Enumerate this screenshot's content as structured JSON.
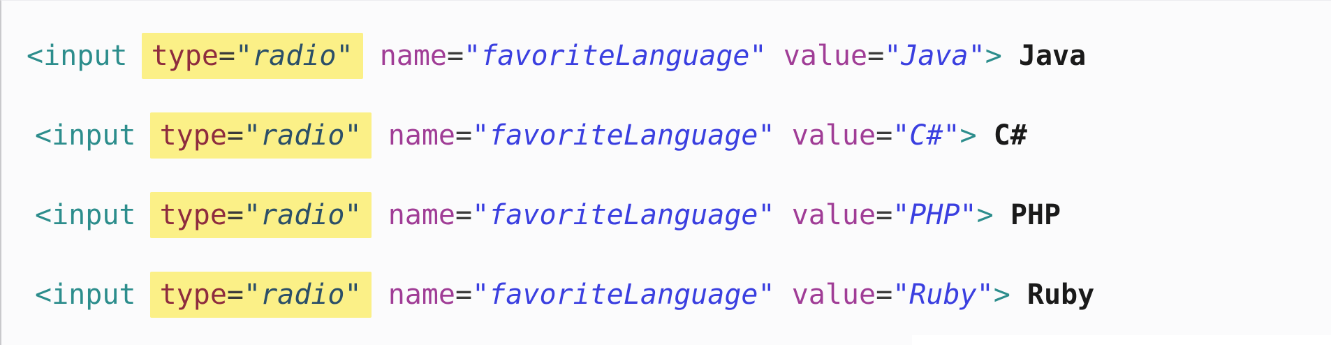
{
  "code_lines": [
    {
      "open": "<input",
      "type_attr": "type",
      "type_eq": "=",
      "type_val": "\"radio\"",
      "name_attr": "name",
      "name_eq": "=",
      "name_val": "\"favoriteLanguage\"",
      "value_attr": "value",
      "value_eq": "=",
      "value_val": "\"Java\"",
      "close": ">",
      "label": "Java"
    },
    {
      "open": "<input",
      "type_attr": "type",
      "type_eq": "=",
      "type_val": "\"radio\"",
      "name_attr": "name",
      "name_eq": "=",
      "name_val": "\"favoriteLanguage\"",
      "value_attr": "value",
      "value_eq": "=",
      "value_val": "\"C#\"",
      "close": ">",
      "label": "C#"
    },
    {
      "open": "<input",
      "type_attr": "type",
      "type_eq": "=",
      "type_val": "\"radio\"",
      "name_attr": "name",
      "name_eq": "=",
      "name_val": "\"favoriteLanguage\"",
      "value_attr": "value",
      "value_eq": "=",
      "value_val": "\"PHP\"",
      "close": ">",
      "label": "PHP"
    },
    {
      "open": "<input",
      "type_attr": "type",
      "type_eq": "=",
      "type_val": "\"radio\"",
      "name_attr": "name",
      "name_eq": "=",
      "name_val": "\"favoriteLanguage\"",
      "value_attr": "value",
      "value_eq": "=",
      "value_val": "\"Ruby\"",
      "close": ">",
      "label": "Ruby"
    }
  ],
  "colors": {
    "tag": "#2c8d8c",
    "attribute": "#a03d96",
    "highlighted_attribute": "#8e2c3e",
    "string": "#3a3fe0",
    "highlight": "#fbf087",
    "label": "#1a1a1a",
    "background": "#fbfbfc"
  }
}
